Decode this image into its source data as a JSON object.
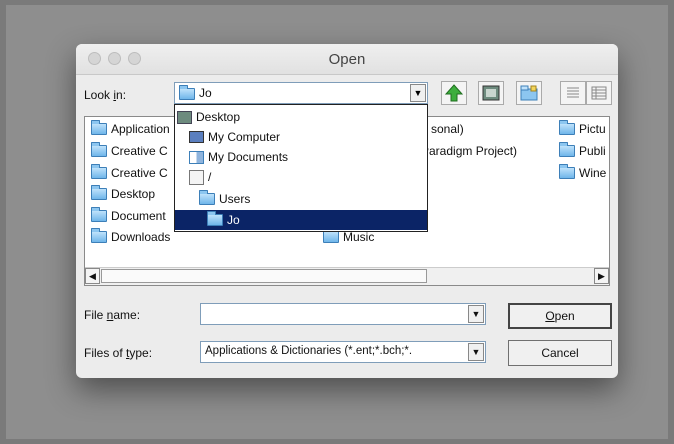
{
  "window": {
    "title": "Open"
  },
  "lookin": {
    "label_pre": "Look ",
    "label_mn": "i",
    "label_post": "n:",
    "value": "Jo"
  },
  "toolbar": {
    "up_icon": "up-folder-icon",
    "home_icon": "home-icon",
    "newfolder_icon": "new-folder-icon",
    "list_icon": "list-view-icon",
    "details_icon": "details-view-icon"
  },
  "files": {
    "col1": [
      "Application",
      "Creative C",
      "Creative C",
      "Desktop",
      "Document",
      "Downloads"
    ],
    "col2": [
      "sonal)",
      "Paradigm Project)",
      "Music"
    ],
    "col3": [
      "Pictu",
      "Publi",
      "Wine"
    ]
  },
  "dropdown": {
    "items": [
      {
        "label": "Desktop",
        "icon": "desktop-icon"
      },
      {
        "label": "My Computer",
        "icon": "computer-icon"
      },
      {
        "label": "My Documents",
        "icon": "documents-icon"
      },
      {
        "label": "/",
        "icon": "drive-icon"
      },
      {
        "label": "Users",
        "icon": "folder-icon"
      },
      {
        "label": "Jo",
        "icon": "folder-icon"
      }
    ]
  },
  "filename": {
    "label_pre": "File ",
    "label_mn": "n",
    "label_post": "ame:",
    "value": ""
  },
  "filetype": {
    "label_pre": "Files of ",
    "label_mn": "t",
    "label_post": "ype:",
    "value": "Applications & Dictionaries (*.ent;*.bch;*."
  },
  "buttons": {
    "open_mn": "O",
    "open_rest": "pen",
    "cancel": "Cancel"
  }
}
